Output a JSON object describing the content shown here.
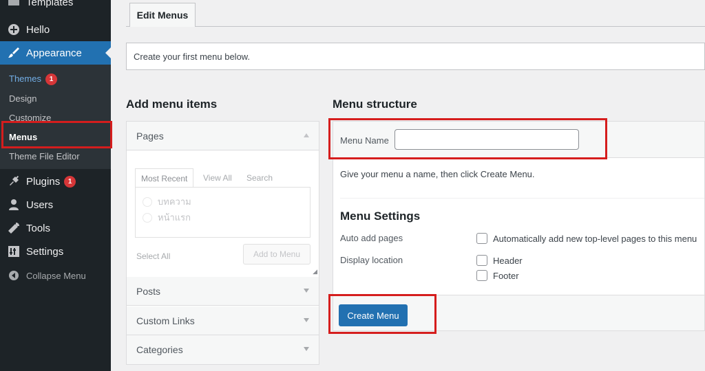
{
  "sidebar": {
    "top_partial": "Templates",
    "items": [
      {
        "label": "Hello",
        "icon": "plus-circle-icon"
      },
      {
        "label": "Appearance",
        "icon": "paintbrush-icon"
      },
      {
        "label": "Plugins",
        "icon": "plugin-icon",
        "badge": "1"
      },
      {
        "label": "Users",
        "icon": "user-icon"
      },
      {
        "label": "Tools",
        "icon": "wrench-icon"
      },
      {
        "label": "Settings",
        "icon": "settings-sliders-icon"
      },
      {
        "label": "Collapse Menu",
        "icon": "collapse-arrow-icon"
      }
    ],
    "submenu": [
      {
        "label": "Themes",
        "badge": "1"
      },
      {
        "label": "Design"
      },
      {
        "label": "Customize"
      },
      {
        "label": "Menus"
      },
      {
        "label": "Theme File Editor"
      }
    ]
  },
  "tab": {
    "label": "Edit Menus"
  },
  "notice": {
    "text": "Create your first menu below."
  },
  "add_items": {
    "title": "Add menu items",
    "pages": {
      "title": "Pages",
      "tabs": [
        "Most Recent",
        "View All",
        "Search"
      ],
      "items": [
        "บทความ",
        "หน้าแรก"
      ],
      "select_all": "Select All",
      "add_button": "Add to Menu"
    },
    "sections": [
      "Posts",
      "Custom Links",
      "Categories"
    ]
  },
  "structure": {
    "title": "Menu structure",
    "menu_name_label": "Menu Name",
    "menu_name_value": "",
    "hint": "Give your menu a name, then click Create Menu.",
    "settings_title": "Menu Settings",
    "auto_add_label": "Auto add pages",
    "auto_add_option": "Automatically add new top-level pages to this menu",
    "display_location_label": "Display location",
    "locations": [
      "Header",
      "Footer"
    ],
    "create_button": "Create Menu"
  },
  "colors": {
    "accent": "#2271b1",
    "sidebar": "#1d2327",
    "highlight": "#d51d1d"
  }
}
